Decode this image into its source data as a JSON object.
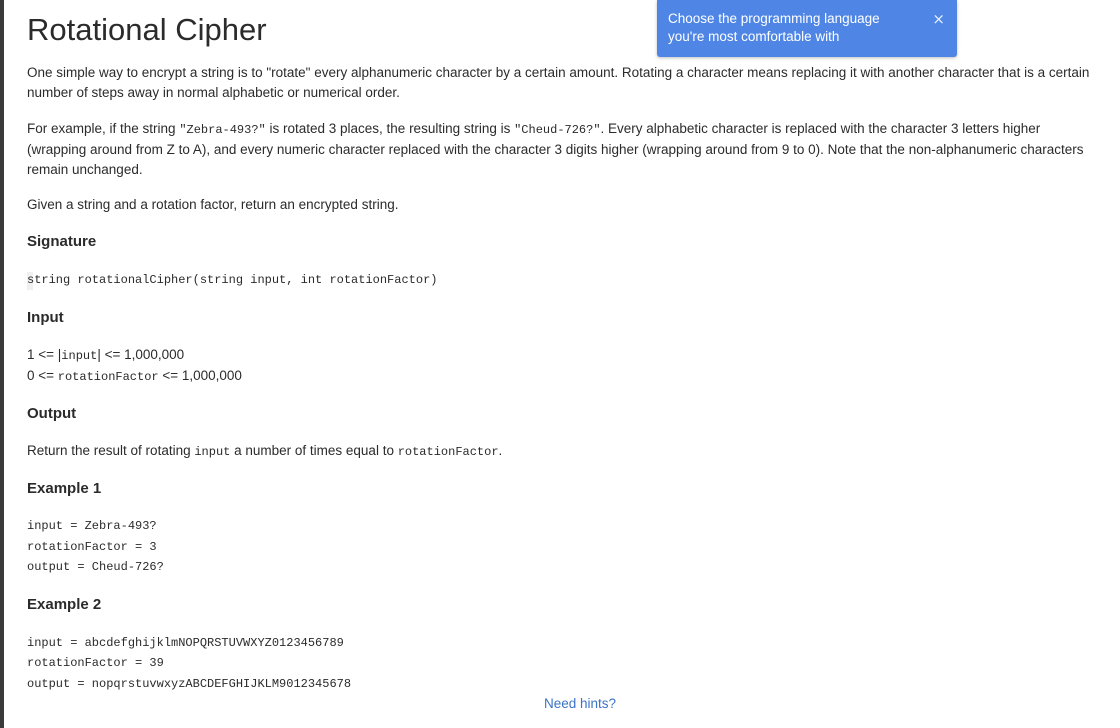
{
  "title": "Rotational Cipher",
  "toast": {
    "message": "Choose the programming language you're most comfortable with",
    "close_glyph": "×"
  },
  "intro": {
    "line1": "One simple way to encrypt a string is to \"rotate\" every alphanumeric character by a certain amount. Rotating a character means replacing it with another character that is a certain",
    "line2": "number of steps away in normal alphabetic or numerical order."
  },
  "example_para": {
    "l1_a": "For example, if the string ",
    "l1_code1": "\"Zebra-493?\"",
    "l1_b": " is rotated 3 places, the resulting string is ",
    "l1_code2": "\"Cheud-726?\"",
    "l1_c": ". Every alphabetic character is replaced with the character 3 letters higher",
    "line2": "(wrapping around from Z to A), and every numeric character replaced with the character 3 digits higher (wrapping around from 9 to 0). Note that the non-alphanumeric characters",
    "line3": "remain unchanged."
  },
  "task": "Given a string and a rotation factor, return an encrypted string.",
  "signature": {
    "heading": "Signature",
    "code": "string rotationalCipher(string input, int rotationFactor)"
  },
  "input": {
    "heading": "Input",
    "c1_a": "1 <= |",
    "c1_code": "input",
    "c1_b": "| <= 1,000,000",
    "c2_a": "0 <= ",
    "c2_code": "rotationFactor",
    "c2_b": " <= 1,000,000"
  },
  "output": {
    "heading": "Output",
    "a": "Return the result of rotating ",
    "code1": "input",
    "b": " a number of times equal to ",
    "code2": "rotationFactor",
    "c": "."
  },
  "example1": {
    "heading": "Example 1",
    "input": "input = Zebra-493?",
    "rotation": "rotationFactor = 3",
    "output": "output = Cheud-726?"
  },
  "example2": {
    "heading": "Example 2",
    "input": "input = abcdefghijklmNOPQRSTUVWXYZ0123456789",
    "rotation": "rotationFactor = 39",
    "output": "output = nopqrstuvwxyzABCDEFGHIJKLM9012345678"
  },
  "hints_link": "Need hints?"
}
